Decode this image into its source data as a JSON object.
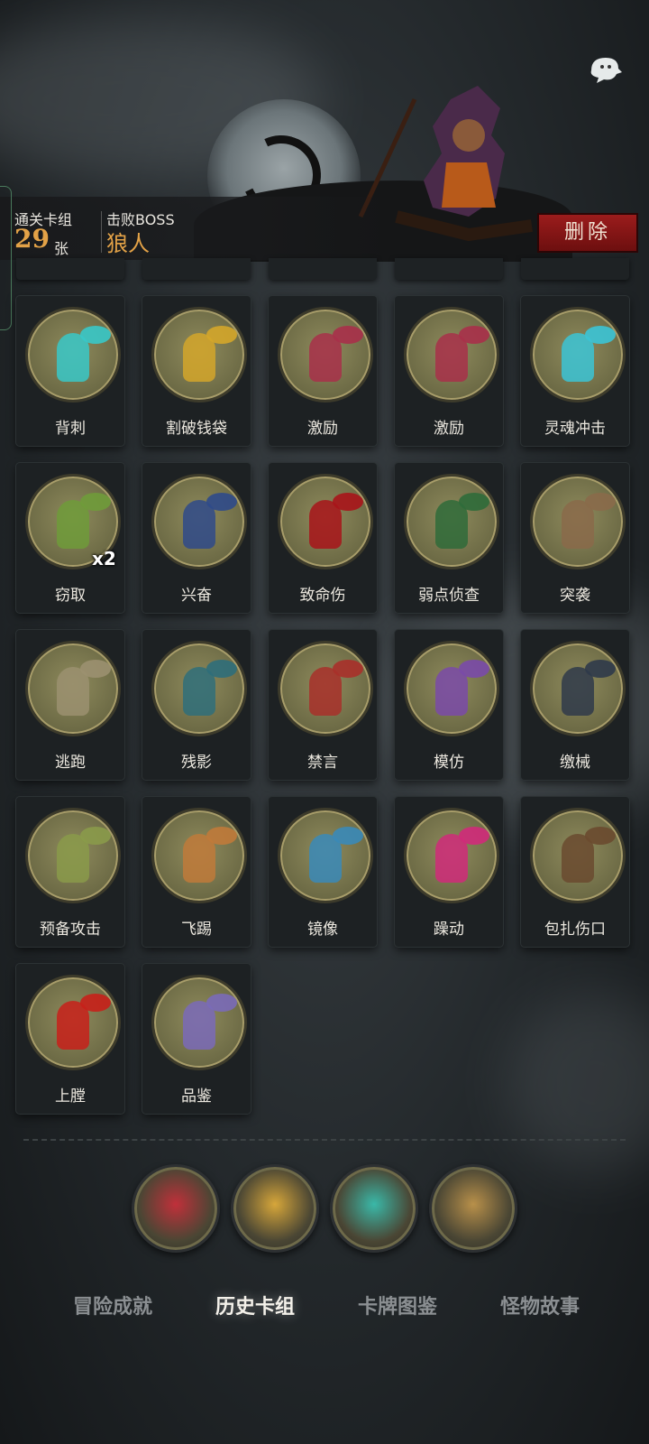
{
  "header": {
    "cleared_deck_label": "通关卡组",
    "card_count": "29",
    "card_unit": "张",
    "boss_label": "击败BOSS",
    "boss_name": "狼人",
    "delete_label": "删除"
  },
  "cards": [
    {
      "name": "背刺",
      "accent": "#38c8c8"
    },
    {
      "name": "割破钱袋",
      "accent": "#d4a62a"
    },
    {
      "name": "激励",
      "accent": "#a8304a"
    },
    {
      "name": "激励",
      "accent": "#a8304a"
    },
    {
      "name": "灵魂冲击",
      "accent": "#3bc4d6"
    },
    {
      "name": "窃取",
      "accent": "#6f9b3a",
      "badge": "x2"
    },
    {
      "name": "兴奋",
      "accent": "#2f4a8a"
    },
    {
      "name": "致命伤",
      "accent": "#a8141a"
    },
    {
      "name": "弱点侦查",
      "accent": "#2f6b3a"
    },
    {
      "name": "突袭",
      "accent": "#8a6a4a"
    },
    {
      "name": "逃跑",
      "accent": "#9b9070"
    },
    {
      "name": "残影",
      "accent": "#2f6e7a"
    },
    {
      "name": "禁言",
      "accent": "#a8302a"
    },
    {
      "name": "模仿",
      "accent": "#7a4aa8"
    },
    {
      "name": "缴械",
      "accent": "#2f3a4a"
    },
    {
      "name": "预备攻击",
      "accent": "#8a9a4a"
    },
    {
      "name": "飞踢",
      "accent": "#c07a3a"
    },
    {
      "name": "镜像",
      "accent": "#3a8ab8"
    },
    {
      "name": "躁动",
      "accent": "#d02a7a"
    },
    {
      "name": "包扎伤口",
      "accent": "#6a4a2f"
    },
    {
      "name": "上膛",
      "accent": "#c8201a"
    },
    {
      "name": "品鉴",
      "accent": "#7a6ab8"
    }
  ],
  "medals": [
    {
      "icon": "skull-icon",
      "color": "#c0303a"
    },
    {
      "icon": "hourglass-icon",
      "color": "#d6a63a"
    },
    {
      "icon": "portal-icon",
      "color": "#3ab8a8"
    },
    {
      "icon": "statue-icon",
      "color": "#b8904a"
    }
  ],
  "tabs": [
    {
      "label": "冒险成就"
    },
    {
      "label": "历史卡组",
      "active": true
    },
    {
      "label": "卡牌图鉴"
    },
    {
      "label": "怪物故事"
    }
  ]
}
